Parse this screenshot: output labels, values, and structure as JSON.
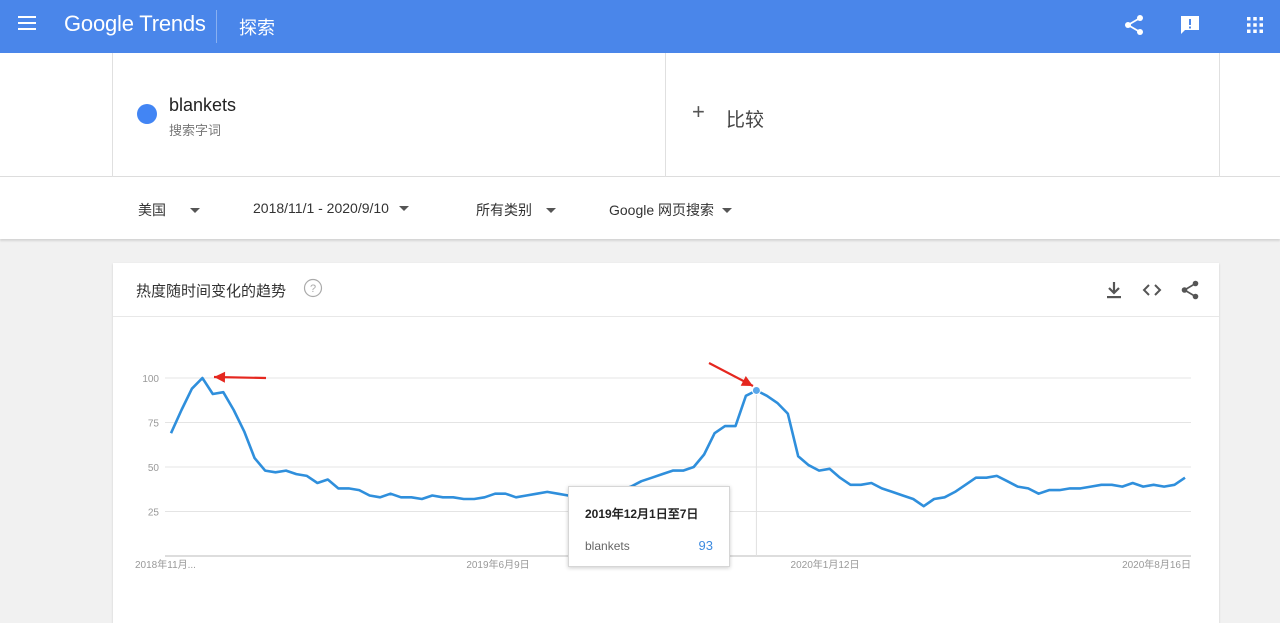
{
  "header": {
    "logo_google": "Google",
    "logo_trends": "Trends",
    "explore": "探索",
    "icons": [
      "menu-icon",
      "share-icon",
      "feedback-icon",
      "apps-icon"
    ],
    "color": "#4a86ea"
  },
  "terms": {
    "term_name": "blankets",
    "term_type": "搜索字词",
    "term_color": "#4285f4",
    "compare_label": "比较"
  },
  "filters": {
    "region": "美国",
    "date_range": "2018/11/1 - 2020/9/10",
    "category": "所有类别",
    "search_type": "Google 网页搜索"
  },
  "chart_card": {
    "title": "热度随时间变化的趋势",
    "icons": [
      "help-icon",
      "download-icon",
      "embed-icon",
      "share-icon"
    ]
  },
  "tooltip": {
    "date": "2019年12月1日至7日",
    "series": "blankets",
    "value": "93"
  },
  "chart_data": {
    "type": "line",
    "y_ticks": [
      "100",
      "75",
      "50",
      "25"
    ],
    "x_tick_labels": [
      "2018年11月...",
      "2019年6月9日",
      "2020年1月12日",
      "2020年8月16日"
    ],
    "ylim": [
      0,
      100
    ],
    "grid": true,
    "line_color": "#2f8fdc",
    "highlight_index": 56,
    "series": [
      {
        "name": "blankets",
        "values": [
          69,
          82,
          94,
          100,
          91,
          92,
          82,
          70,
          55,
          48,
          47,
          48,
          46,
          45,
          41,
          43,
          38,
          38,
          37,
          34,
          33,
          35,
          33,
          33,
          32,
          34,
          33,
          33,
          32,
          32,
          33,
          35,
          35,
          33,
          34,
          35,
          36,
          35,
          34,
          35,
          36,
          36,
          37,
          37,
          39,
          42,
          44,
          46,
          48,
          48,
          50,
          57,
          69,
          73,
          73,
          90,
          93,
          90,
          86,
          80,
          56,
          51,
          48,
          49,
          44,
          40,
          40,
          41,
          38,
          36,
          34,
          32,
          28,
          32,
          33,
          36,
          40,
          44,
          44,
          45,
          42,
          39,
          38,
          35,
          37,
          37,
          38,
          38,
          39,
          40,
          40,
          39,
          41,
          39,
          40,
          39,
          40,
          44
        ]
      }
    ]
  }
}
